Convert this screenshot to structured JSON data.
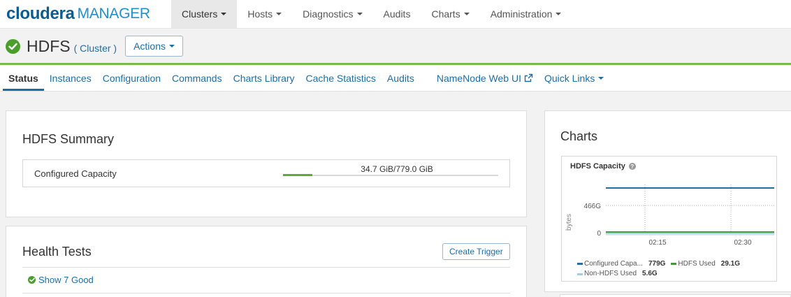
{
  "logo": {
    "part1": "cloudera",
    "part2": "MANAGER"
  },
  "topnav": [
    {
      "label": "Clusters",
      "caret": true,
      "active": true
    },
    {
      "label": "Hosts",
      "caret": true
    },
    {
      "label": "Diagnostics",
      "caret": true
    },
    {
      "label": "Audits",
      "caret": false
    },
    {
      "label": "Charts",
      "caret": true
    },
    {
      "label": "Administration",
      "caret": true
    }
  ],
  "header": {
    "title": "HDFS",
    "cluster_link": "( Cluster )",
    "actions_label": "Actions"
  },
  "tabs": [
    {
      "label": "Status",
      "active": true
    },
    {
      "label": "Instances"
    },
    {
      "label": "Configuration"
    },
    {
      "label": "Commands"
    },
    {
      "label": "Charts Library"
    },
    {
      "label": "Cache Statistics"
    },
    {
      "label": "Audits"
    },
    {
      "label": "NameNode Web UI",
      "external": true
    },
    {
      "label": "Quick Links",
      "caret": true
    }
  ],
  "summary": {
    "title": "HDFS Summary",
    "capacity_label": "Configured Capacity",
    "capacity_text": "34.7 GiB/779.0 GiB",
    "capacity_fraction": 0.0445
  },
  "health": {
    "title": "Health Tests",
    "create_trigger": "Create Trigger",
    "show_good": "Show 7 Good"
  },
  "charts_panel": {
    "title": "Charts"
  },
  "colors": {
    "accent": "#1a6ea8",
    "good": "#4a9e2c",
    "rule": "#78b94d"
  },
  "chart_data": {
    "type": "line",
    "title": "HDFS Capacity",
    "ylabel": "bytes",
    "xlabel": "",
    "x_ticks": [
      "02:15",
      "02:30"
    ],
    "y_ticks": [
      "0",
      "466G"
    ],
    "ylim": [
      0,
      779
    ],
    "grid": true,
    "legend_placement": "bottom",
    "series": [
      {
        "name": "Configured Capa...",
        "legend_value": "779G",
        "color": "#1f6fa8",
        "values": [
          779,
          779,
          779
        ]
      },
      {
        "name": "HDFS Used",
        "legend_value": "29.1G",
        "color": "#3e9b32",
        "values": [
          29.1,
          29.1,
          29.1
        ]
      },
      {
        "name": "Non-HDFS Used",
        "legend_value": "5.6G",
        "color": "#9fcfe6",
        "values": [
          5.6,
          5.6,
          5.6
        ]
      }
    ]
  }
}
